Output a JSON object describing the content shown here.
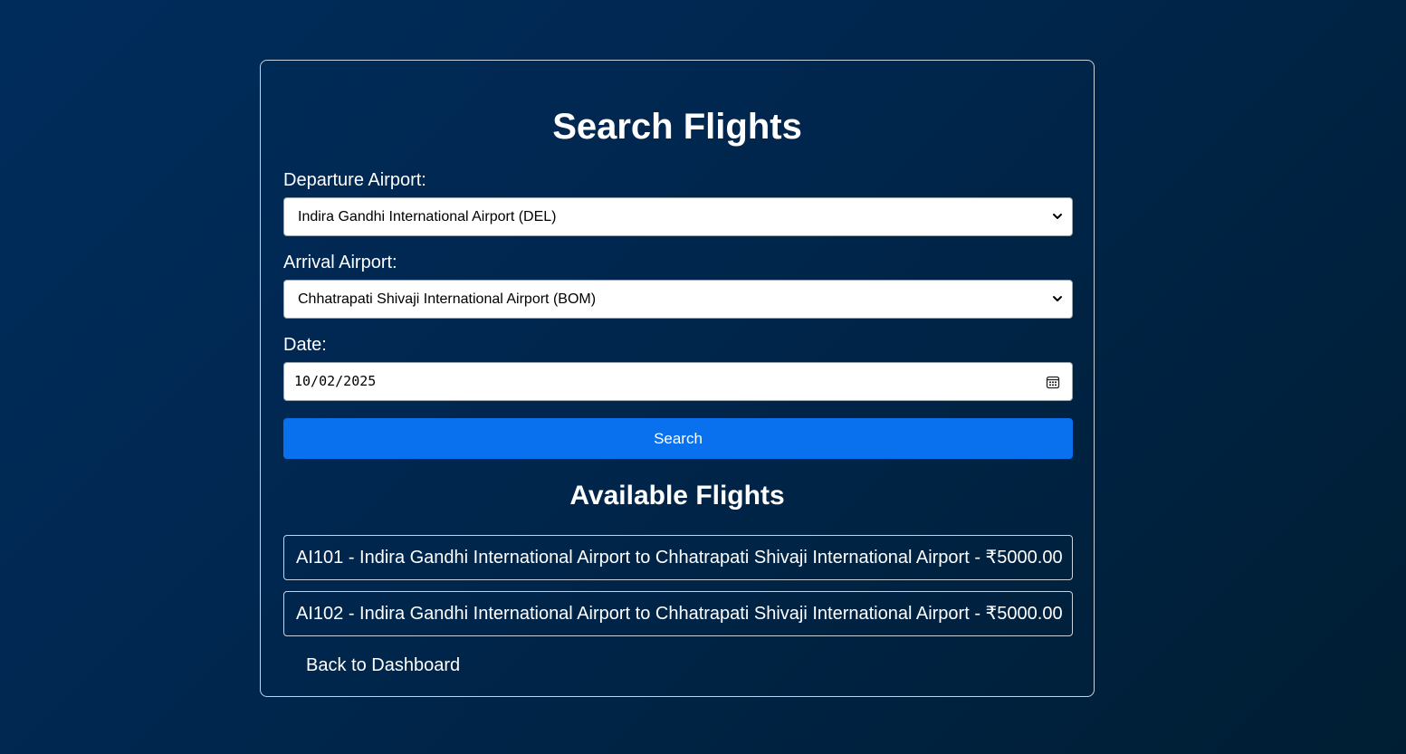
{
  "form": {
    "title": "Search Flights",
    "departure": {
      "label": "Departure Airport:",
      "selected": "Indira Gandhi International Airport (DEL)"
    },
    "arrival": {
      "label": "Arrival Airport:",
      "selected": "Chhatrapati Shivaji International Airport (BOM)"
    },
    "date": {
      "label": "Date:",
      "value": "10/02/2025"
    },
    "search_label": "Search"
  },
  "results": {
    "title": "Available Flights",
    "flights": [
      "AI101 - Indira Gandhi International Airport to Chhatrapati Shivaji International Airport - ₹5000.00",
      "AI102 - Indira Gandhi International Airport to Chhatrapati Shivaji International Airport - ₹5000.00"
    ]
  },
  "back_link": "Back to Dashboard",
  "colors": {
    "background": "#002c5c",
    "button": "#0970ee",
    "text": "#ffffff"
  },
  "icons": [
    "chevron-down-icon",
    "calendar-icon"
  ]
}
